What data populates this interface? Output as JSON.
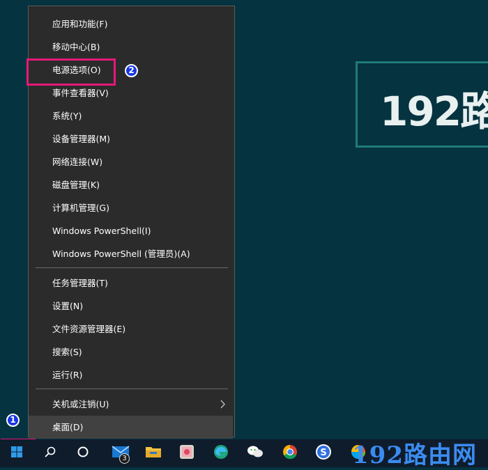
{
  "desktop": {
    "banner_text": "192路"
  },
  "menu": {
    "items": [
      {
        "label": "应用和功能(F)"
      },
      {
        "label": "移动中心(B)"
      },
      {
        "label": "电源选项(O)"
      },
      {
        "label": "事件查看器(V)"
      },
      {
        "label": "系统(Y)"
      },
      {
        "label": "设备管理器(M)"
      },
      {
        "label": "网络连接(W)"
      },
      {
        "label": "磁盘管理(K)"
      },
      {
        "label": "计算机管理(G)"
      },
      {
        "label": "Windows PowerShell(I)"
      },
      {
        "label": "Windows PowerShell (管理员)(A)"
      },
      {
        "label": "任务管理器(T)"
      },
      {
        "label": "设置(N)"
      },
      {
        "label": "文件资源管理器(E)"
      },
      {
        "label": "搜索(S)"
      },
      {
        "label": "运行(R)"
      },
      {
        "label": "关机或注销(U)",
        "has_submenu": true
      },
      {
        "label": "桌面(D)",
        "active": true
      }
    ]
  },
  "annotations": {
    "step1": "1",
    "step2": "2",
    "highlight_color": "#e6187a"
  },
  "taskbar": {
    "mail_badge": "3",
    "icons": [
      "windows-start-icon",
      "search-icon",
      "cortana-icon",
      "mail-icon",
      "file-explorer-icon",
      "photos-app-icon",
      "edge-icon",
      "wechat-icon",
      "chrome-icon",
      "sogou-icon",
      "color-app-icon"
    ]
  },
  "watermark": {
    "text": "192路由网"
  }
}
